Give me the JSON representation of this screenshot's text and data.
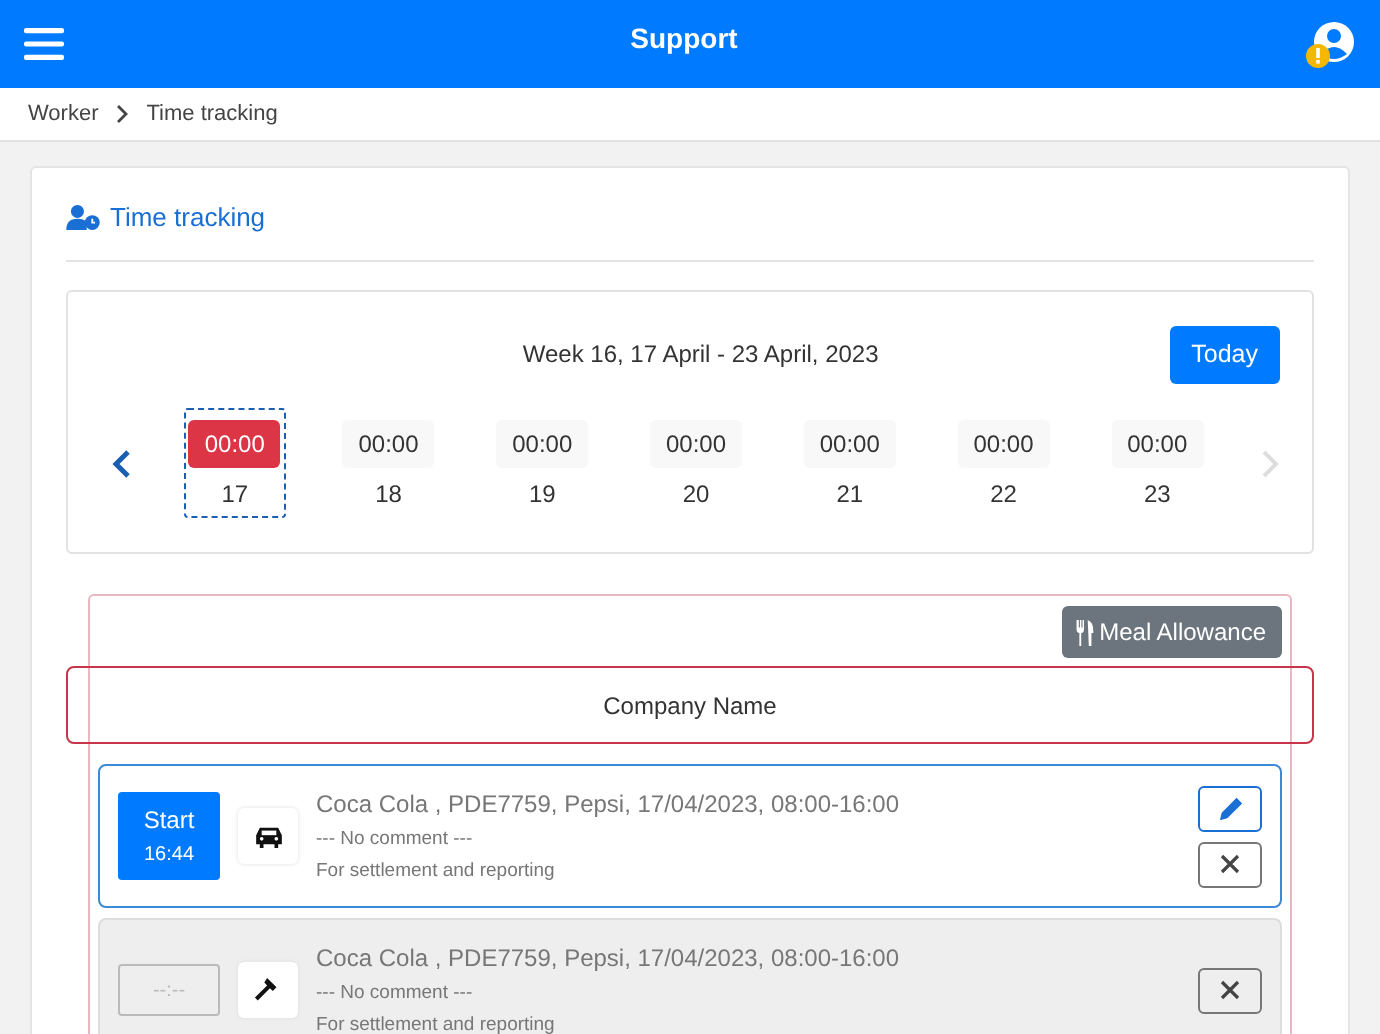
{
  "app_bar": {
    "title": "Support",
    "user_alert": true
  },
  "breadcrumb": [
    "Worker",
    "Time tracking"
  ],
  "section": {
    "title": "Time tracking"
  },
  "week": {
    "title": "Week 16, 17 April - 23 April, 2023",
    "today_button": "Today",
    "next_disabled": true,
    "days": [
      {
        "time": "00:00",
        "day": "17",
        "selected": true
      },
      {
        "time": "00:00",
        "day": "18",
        "selected": false
      },
      {
        "time": "00:00",
        "day": "19",
        "selected": false
      },
      {
        "time": "00:00",
        "day": "20",
        "selected": false
      },
      {
        "time": "00:00",
        "day": "21",
        "selected": false
      },
      {
        "time": "00:00",
        "day": "22",
        "selected": false
      },
      {
        "time": "00:00",
        "day": "23",
        "selected": false
      }
    ]
  },
  "meal_button": "Meal Allowance",
  "company": "Company Name",
  "entries": [
    {
      "selected": true,
      "start_label": "Start",
      "start_time": "16:44",
      "kind": "car",
      "title": "Coca Cola , PDE7759, Pepsi, 17/04/2023, 08:00-16:00",
      "comment": "--- No comment ---",
      "note": "For settlement and reporting",
      "editable": true
    },
    {
      "selected": false,
      "start_placeholder": "--:--",
      "kind": "hammer",
      "title": "Coca Cola , PDE7759, Pepsi, 17/04/2023, 08:00-16:00",
      "comment": "--- No comment ---",
      "note": "For settlement and reporting",
      "editable": false
    }
  ]
}
